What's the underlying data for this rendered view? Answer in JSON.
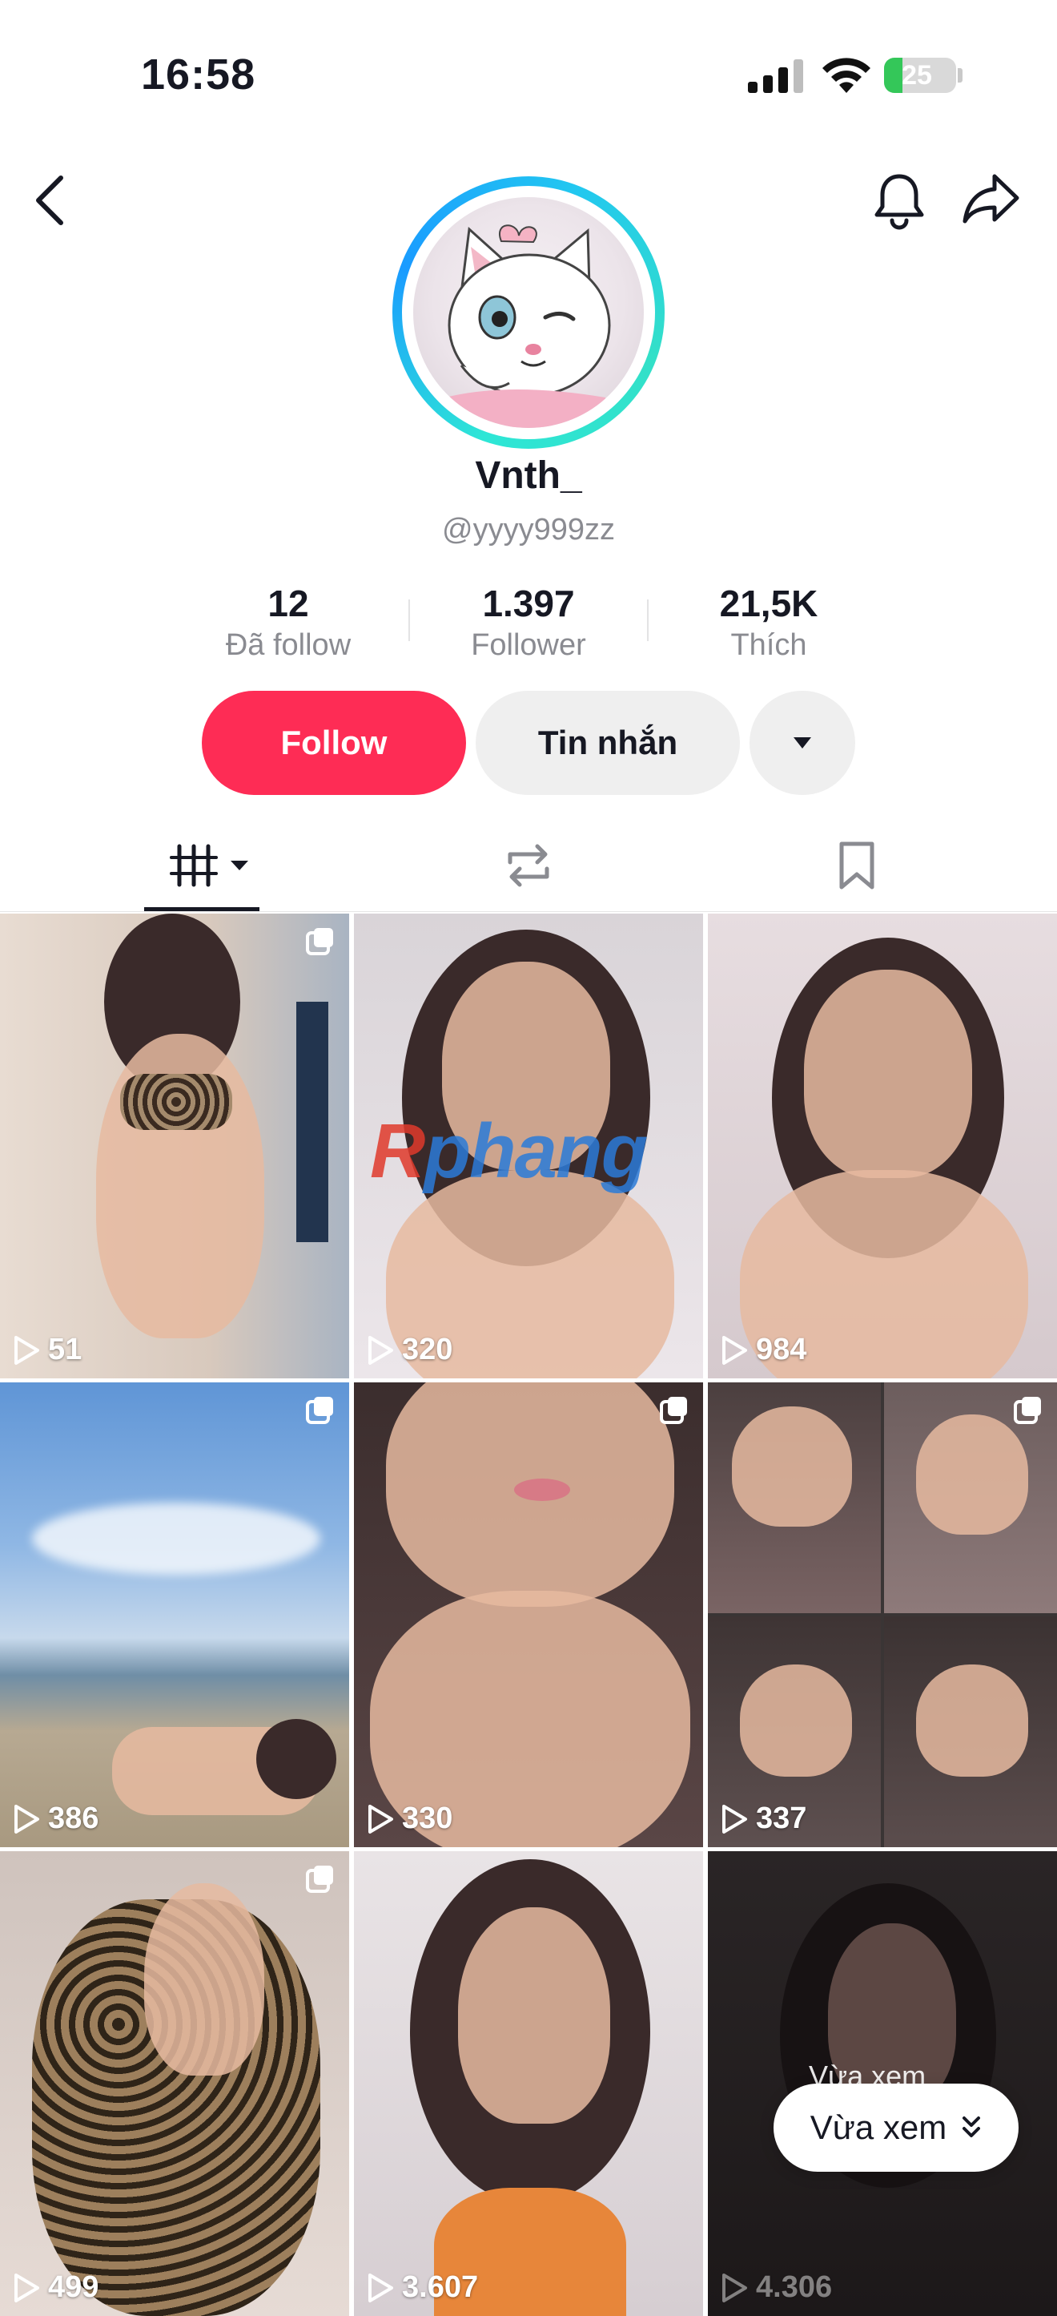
{
  "status_bar": {
    "time": "16:58",
    "battery": "25"
  },
  "profile": {
    "name": "Vnth_",
    "handle": "@yyyy999zz",
    "stats": [
      {
        "value": "12",
        "label": "Đã follow"
      },
      {
        "value": "1.397",
        "label": "Follower"
      },
      {
        "value": "21,5K",
        "label": "Thích"
      }
    ]
  },
  "actions": {
    "follow": "Follow",
    "message": "Tin nhắn"
  },
  "tabs": {
    "selected": "videos"
  },
  "watermark": {
    "part1": "R",
    "part2": "phang"
  },
  "videos": [
    {
      "views": "51"
    },
    {
      "views": "320"
    },
    {
      "views": "984"
    },
    {
      "views": "386"
    },
    {
      "views": "330"
    },
    {
      "views": "337"
    },
    {
      "views": "499"
    },
    {
      "views": "3.607"
    },
    {
      "views": "4.306"
    }
  ],
  "recent": {
    "label": "Vừa xem",
    "ghost_label": "Vừa xem"
  },
  "colors": {
    "accent": "#fe2c55",
    "avatar_ring": "#22c7f0",
    "battery": "#34c759"
  }
}
